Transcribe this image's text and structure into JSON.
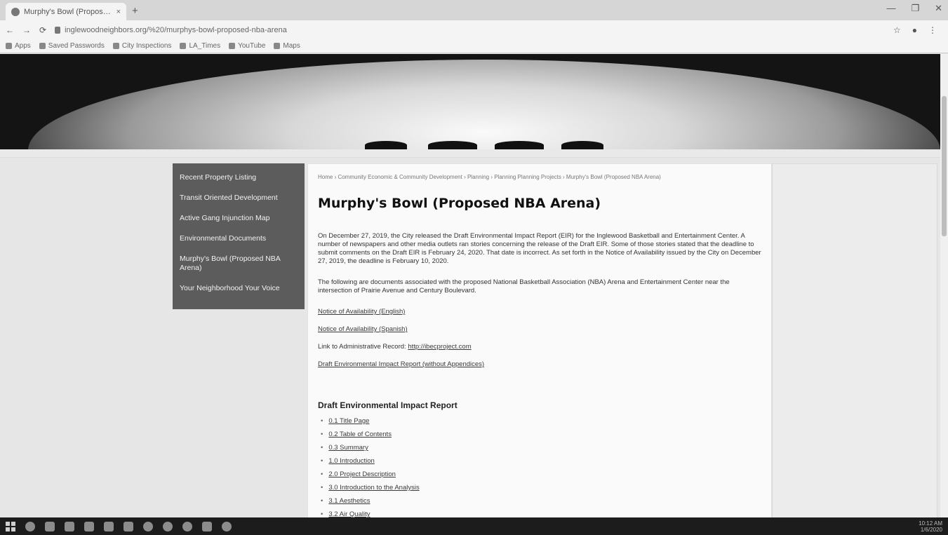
{
  "browser": {
    "tab_title": "Murphy's Bowl (Proposed NBA ...",
    "tab_close": "×",
    "new_tab": "+",
    "window_controls": [
      "—",
      "❐",
      "✕"
    ],
    "url": "inglewoodneighbors.org/%20/murphys-bowl-proposed-nba-arena",
    "bookmarks": [
      "Apps",
      "Saved Passwords",
      "City Inspections",
      "LA_Times",
      "YouTube",
      "Maps"
    ]
  },
  "sidebar": {
    "items": [
      "Recent Property Listing",
      "Transit Oriented Development",
      "Active Gang Injunction Map",
      "Environmental Documents",
      "Murphy's Bowl (Proposed NBA Arena)",
      "Your Neighborhood Your Voice"
    ]
  },
  "main": {
    "breadcrumb": "Home › Community Economic & Community Development › Planning › Planning Planning Projects › Murphy's Bowl (Proposed NBA Arena)",
    "title": "Murphy's Bowl (Proposed NBA Arena)",
    "para1": "On December 27, 2019, the City released the Draft Environmental Impact Report (EIR) for the Inglewood Basketball and Entertainment Center. A number of newspapers and other media outlets ran stories concerning the release of the Draft EIR. Some of those stories stated that the deadline to submit comments on the Draft EIR is February 24, 2020. That date is incorrect. As set forth in the Notice of Availability issued by the City on December 27, 2019, the deadline is February 10, 2020.",
    "para2": "The following are documents associated with the proposed National Basketball Association (NBA) Arena and Entertainment Center near the intersection of Prairie Avenue and Century Boulevard.",
    "link1": "Notice of Availability (English)",
    "link2": "Notice of Availability (Spanish)",
    "record_label": "Link to Administrative Record:",
    "record_link": "http://ibecproject.com",
    "link3": "Draft Environmental Impact Report (without Appendices)",
    "section_title": "Draft Environmental Impact Report",
    "toc": [
      "0.1 Title Page",
      "0.2 Table of Contents",
      "0.3 Summary",
      "1.0 Introduction",
      "2.0 Project Description",
      "3.0 Introduction to the Analysis",
      "3.1 Aesthetics",
      "3.2 Air Quality"
    ]
  },
  "taskbar": {
    "time": "10:12 AM",
    "date": "1/6/2020"
  }
}
